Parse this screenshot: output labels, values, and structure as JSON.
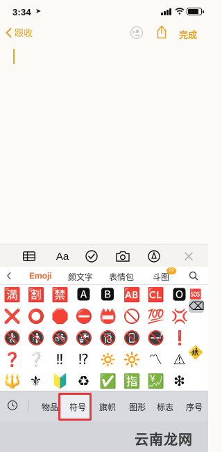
{
  "status": {
    "time": "3:34",
    "location_glyph": "➤"
  },
  "nav": {
    "back_label": "跟收",
    "done_label": "完成"
  },
  "toolbar": {
    "aa_label": "Aa"
  },
  "keyboard": {
    "categories": [
      "Emoji",
      "颜文字",
      "表情包",
      "斗图"
    ],
    "badge": "24",
    "emoji_rows": [
      [
        "🈵",
        "🈹",
        "🈲",
        "🅰",
        "🅱",
        "🆎",
        "🆑",
        "🅾"
      ],
      [
        "❌",
        "⭕",
        "🛑",
        "⛔",
        "📛",
        "🚫",
        "💯",
        "💢"
      ],
      [
        "🚷",
        "🚯",
        "🚳",
        "🚱",
        "🔞",
        "📵",
        "🚭",
        "❗"
      ],
      [
        "❓",
        "❔",
        "‼",
        "⁉",
        "🔅",
        "🔆",
        "〽",
        "⚠"
      ],
      [
        "🔱",
        "⚜",
        "🔰",
        "♻",
        "✅",
        "🈯",
        "💹",
        "❇"
      ]
    ],
    "extra_icons": [
      "🆘",
      "⌫",
      "🚸"
    ],
    "tabs": [
      "物品",
      "符号",
      "旗帜",
      "图形",
      "标志",
      "序号"
    ]
  },
  "watermark": "云南龙网"
}
